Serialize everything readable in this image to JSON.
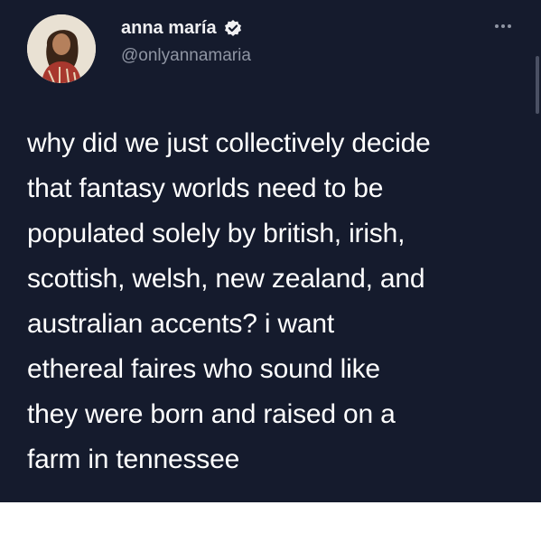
{
  "tweet": {
    "display_name": "anna maría",
    "handle": "@onlyannamaria",
    "text": "why did we just collectively decide\nthat fantasy worlds need to be\npopulated solely by british, irish,\nscottish, welsh, new zealand, and\naustralian accents? i want\nethereal faires who sound like\nthey were born and raised on a\nfarm in tennessee"
  },
  "icons": {
    "verified": "verified-badge-icon",
    "more": "more-options-icon"
  },
  "colors": {
    "background": "#151b2d",
    "text": "#ffffff",
    "secondary_text": "#8f95a3"
  }
}
